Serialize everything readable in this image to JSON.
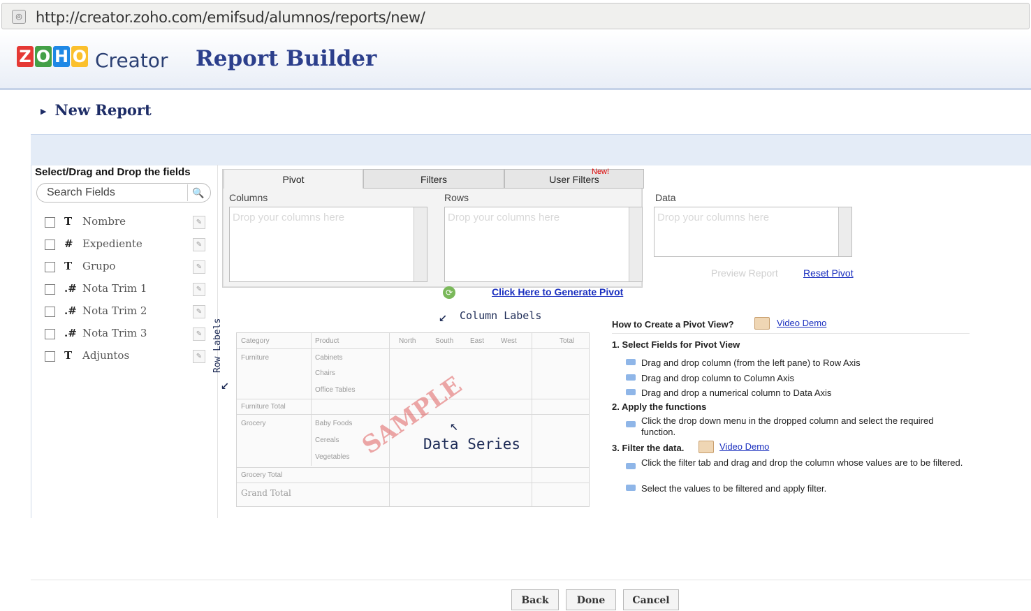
{
  "browser": {
    "url": "http://creator.zoho.com/emifsud/alumnos/reports/new/"
  },
  "header": {
    "logo_letters": [
      "Z",
      "O",
      "H",
      "O"
    ],
    "logo_colors": [
      "#e53935",
      "#43a047",
      "#1e88e5",
      "#fbc02d"
    ],
    "product": "Creator",
    "title": "Report Builder"
  },
  "page": {
    "heading": "New Report"
  },
  "fields_panel": {
    "title": "Select/Drag and Drop the fields",
    "search_placeholder": "Search Fields",
    "fields": [
      {
        "type": "T",
        "name": "Nombre"
      },
      {
        "type": "#",
        "name": "Expediente"
      },
      {
        "type": "T",
        "name": "Grupo"
      },
      {
        "type": ".#",
        "name": "Nota Trim 1"
      },
      {
        "type": ".#",
        "name": "Nota Trim 2"
      },
      {
        "type": ".#",
        "name": "Nota Trim 3"
      },
      {
        "type": "T",
        "name": "Adjuntos"
      }
    ]
  },
  "tabs": {
    "pivot": "Pivot",
    "filters": "Filters",
    "user_filters": "User Filters",
    "new_badge": "New!"
  },
  "pivot": {
    "columns_label": "Columns",
    "rows_label": "Rows",
    "data_label": "Data",
    "drop_placeholder": "Drop your columns here",
    "preview_button": "Preview Report",
    "reset_link": "Reset Pivot",
    "generate_link": "Click Here to Generate Pivot"
  },
  "sample": {
    "column_labels_note": "Column Labels",
    "row_labels_note": "Row Labels",
    "data_series_note": "Data Series",
    "watermark": "SAMPLE",
    "headers": [
      "Category",
      "Product",
      "North",
      "South",
      "East",
      "West",
      "Total"
    ],
    "rows": [
      "Furniture",
      "Cabinets",
      "Chairs",
      "Office Tables",
      "Furniture Total",
      "Grocery",
      "Baby Foods",
      "Cereals",
      "Vegetables",
      "Grocery Total",
      "Grand Total"
    ]
  },
  "help": {
    "title": "How to Create a Pivot View?",
    "video_demo": "Video Demo",
    "step1": "1. Select Fields for Pivot View",
    "step1_items": [
      "Drag and drop column (from the left pane) to Row Axis",
      "Drag and drop column to Column Axis",
      "Drag and drop a numerical column to Data Axis"
    ],
    "step2": "2. Apply the functions",
    "step2_items": [
      "Click the drop down menu in the dropped column and select the required function."
    ],
    "step3": "3. Filter the data.",
    "step3_items": [
      "Click the filter tab and drag and drop the column whose values are to be filtered.",
      "Select the values to be filtered and apply filter."
    ]
  },
  "footer": {
    "back": "Back",
    "done": "Done",
    "cancel": "Cancel"
  }
}
